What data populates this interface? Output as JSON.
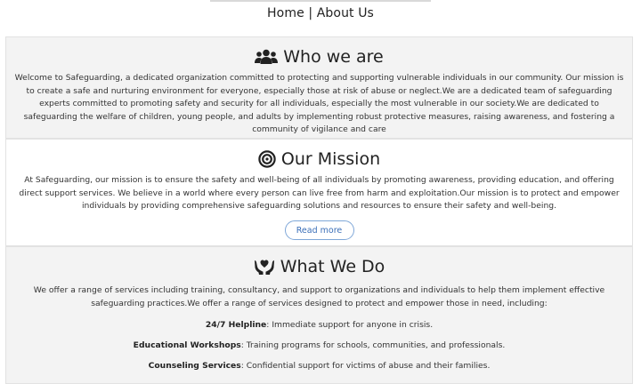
{
  "breadcrumb": {
    "home": "Home",
    "separator": "|",
    "current": "About Us"
  },
  "who_we_are": {
    "icon": "users-icon",
    "title": "Who we are",
    "text": "Welcome to Safeguarding, a dedicated organization committed to protecting and supporting vulnerable individuals in our community. Our mission is to create a safe and nurturing environment for everyone, especially those at risk of abuse or neglect.We are a dedicated team of safeguarding experts committed to promoting safety and security for all individuals, especially the most vulnerable in our society.We are dedicated to safeguarding the welfare of children, young people, and adults by implementing robust protective measures, raising awareness, and fostering a community of vigilance and care"
  },
  "our_mission": {
    "icon": "target-icon",
    "title": "Our Mission",
    "text": "At Safeguarding, our mission is to ensure the safety and well-being of all individuals by promoting awareness, providing education, and offering direct support services. We believe in a world where every person can live free from harm and exploitation.Our mission is to protect and empower individuals by providing comprehensive safeguarding solutions and resources to ensure their safety and well-being.",
    "button_label": "Read more"
  },
  "what_we_do": {
    "icon": "hands-heart-icon",
    "title": "What We Do",
    "text": "We offer a range of services including training, consultancy, and support to organizations and individuals to help them implement effective safeguarding practices.We offer a range of services designed to protect and empower those in need, including:",
    "services": [
      {
        "name": "24/7 Helpline",
        "desc": ": Immediate support for anyone in crisis."
      },
      {
        "name": "Educational Workshops",
        "desc": ": Training programs for schools, communities, and professionals."
      },
      {
        "name": "Counseling Services",
        "desc": ": Confidential support for victims of abuse and their families."
      }
    ]
  }
}
